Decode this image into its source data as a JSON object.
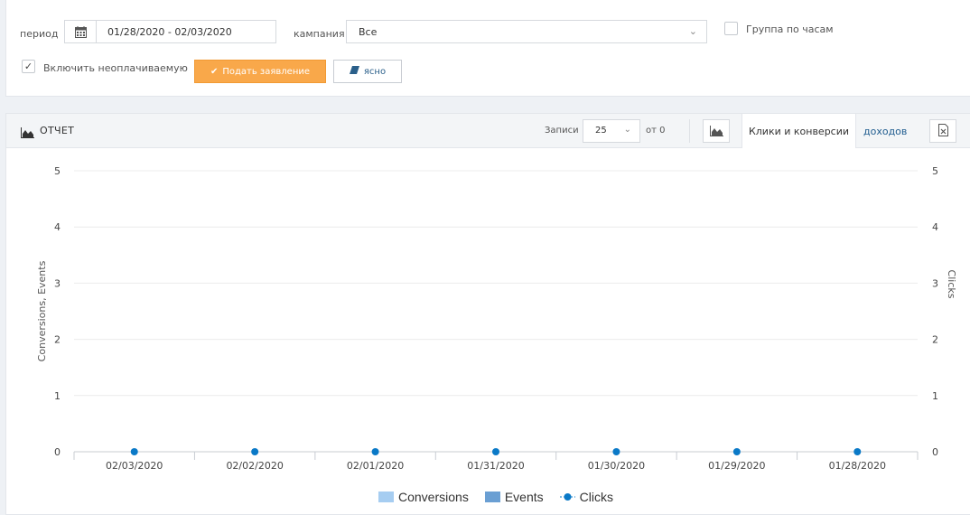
{
  "filters": {
    "period_label": "период",
    "date_range": "01/28/2020 - 02/03/2020",
    "campaign_label": "кампания",
    "campaign_value": "Все",
    "group_by_hours_label": "Группа по часам",
    "group_by_hours_checked": false,
    "include_unpaid_label": "Включить неоплачиваемую",
    "include_unpaid_checked": true,
    "apply_label": "Подать заявление",
    "clear_label": "ясно"
  },
  "report": {
    "title": "ОТЧЕТ",
    "records_label": "Записи",
    "records_value": "25",
    "of_label": "от 0",
    "tabs": [
      "Клики и конверсии",
      "доходов"
    ],
    "active_tab": 0
  },
  "colors": {
    "conversions": "#a6cdf1",
    "events": "#6a9fd3",
    "clicks": "#0a79c7",
    "apply_button": "#f9a84a"
  },
  "chart_data": {
    "type": "line",
    "categories": [
      "02/03/2020",
      "02/02/2020",
      "02/01/2020",
      "01/31/2020",
      "01/30/2020",
      "01/29/2020",
      "01/28/2020"
    ],
    "series": [
      {
        "name": "Conversions",
        "type": "bar",
        "values": [
          0,
          0,
          0,
          0,
          0,
          0,
          0
        ]
      },
      {
        "name": "Events",
        "type": "bar",
        "values": [
          0,
          0,
          0,
          0,
          0,
          0,
          0
        ]
      },
      {
        "name": "Clicks",
        "type": "line",
        "values": [
          0,
          0,
          0,
          0,
          0,
          0,
          0
        ]
      }
    ],
    "ylabel": "Conversions, Events",
    "y2label": "Clicks",
    "ylim": [
      0,
      5
    ],
    "y2lim": [
      0,
      5
    ],
    "yticks": [
      "0",
      "1",
      "2",
      "3",
      "4",
      "5"
    ],
    "grid": true,
    "legend": "bottom-center"
  }
}
